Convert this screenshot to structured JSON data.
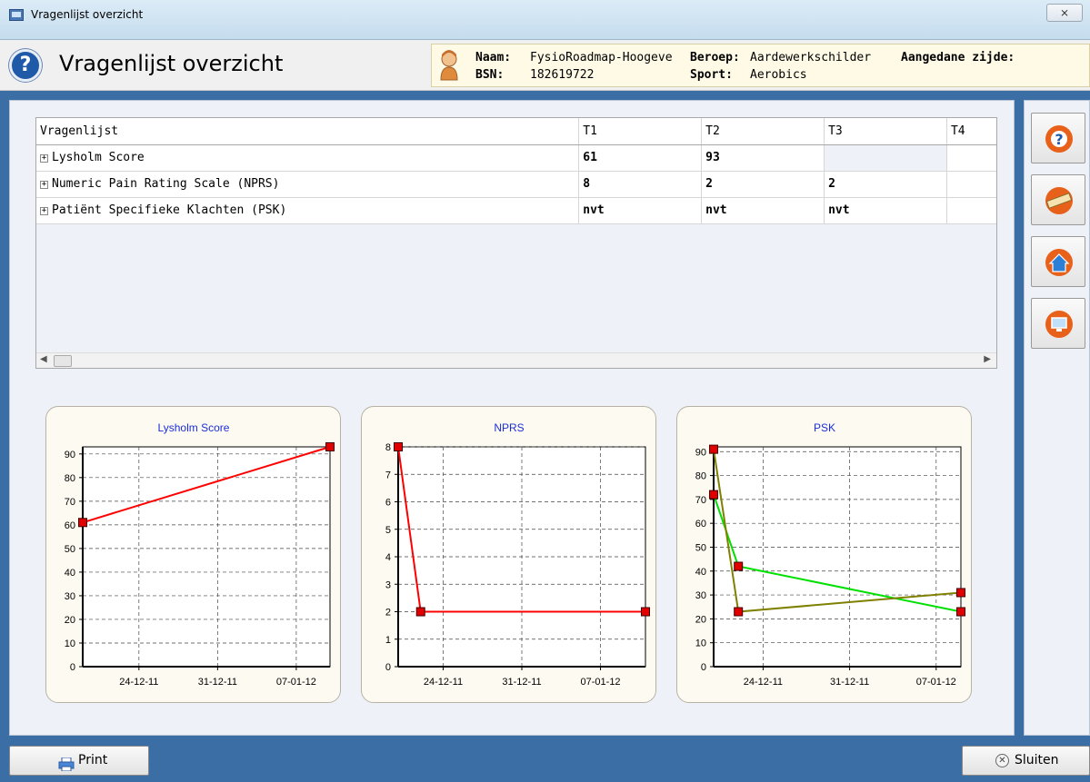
{
  "window": {
    "title": "Vragenlijst overzicht",
    "close_glyph": "⨯"
  },
  "header": {
    "title": "Vragenlijst overzicht",
    "help_icon": "question-icon"
  },
  "patient": {
    "naam_label": "Naam:",
    "naam": "FysioRoadmap-Hoogeve",
    "bsn_label": "BSN:",
    "bsn": "182619722",
    "beroep_label": "Beroep:",
    "beroep": "Aardewerkschilder",
    "sport_label": "Sport:",
    "sport": "Aerobics",
    "zijde_label": "Aangedane zijde:"
  },
  "grid": {
    "columns": [
      "Vragenlijst",
      "T1",
      "T2",
      "T3",
      "T4"
    ],
    "rows": [
      {
        "name": "Lysholm Score",
        "values": [
          "61",
          "93",
          "",
          ""
        ]
      },
      {
        "name": "Numeric Pain Rating Scale (NPRS)",
        "values": [
          "8",
          "2",
          "2",
          ""
        ]
      },
      {
        "name": "Patiënt Specifieke Klachten (PSK)",
        "values": [
          "nvt",
          "nvt",
          "nvt",
          ""
        ]
      }
    ]
  },
  "chart_data": [
    {
      "type": "line",
      "title": "Lysholm Score",
      "x_ticks": [
        "24-12-11",
        "31-12-11",
        "07-01-12"
      ],
      "y_ticks": [
        "0",
        "10",
        "20",
        "30",
        "40",
        "50",
        "60",
        "70",
        "80",
        "90"
      ],
      "ylim": [
        0,
        93
      ],
      "series": [
        {
          "color": "#ff0000",
          "points": [
            {
              "x": "2011-12-19",
              "y": 61
            },
            {
              "x": "2012-01-10",
              "y": 93
            }
          ]
        }
      ]
    },
    {
      "type": "line",
      "title": "NPRS",
      "x_ticks": [
        "24-12-11",
        "31-12-11",
        "07-01-12"
      ],
      "y_ticks": [
        "0",
        "1",
        "2",
        "3",
        "4",
        "5",
        "6",
        "7",
        "8"
      ],
      "ylim": [
        0,
        8
      ],
      "series": [
        {
          "color": "#ff0000",
          "points": [
            {
              "x": "2011-12-20",
              "y": 8
            },
            {
              "x": "2011-12-22",
              "y": 2
            },
            {
              "x": "2012-01-11",
              "y": 2
            }
          ]
        }
      ]
    },
    {
      "type": "line",
      "title": "PSK",
      "x_ticks": [
        "24-12-11",
        "31-12-11",
        "07-01-12"
      ],
      "y_ticks": [
        "0",
        "10",
        "20",
        "30",
        "40",
        "50",
        "60",
        "70",
        "80",
        "90"
      ],
      "ylim": [
        0,
        92
      ],
      "series": [
        {
          "color": "#00e000",
          "points": [
            {
              "x": "2011-12-20",
              "y": 72
            },
            {
              "x": "2011-12-22",
              "y": 42
            },
            {
              "x": "2012-01-09",
              "y": 23
            }
          ]
        },
        {
          "color": "#808000",
          "points": [
            {
              "x": "2011-12-20",
              "y": 91
            },
            {
              "x": "2011-12-22",
              "y": 23
            },
            {
              "x": "2012-01-09",
              "y": 31
            }
          ]
        }
      ]
    }
  ],
  "sidebar": {
    "buttons": [
      {
        "icon": "help-lifebuoy-icon",
        "color": "#e8611a"
      },
      {
        "icon": "ruler-icon",
        "color": "#e8611a"
      },
      {
        "icon": "home-icon",
        "color": "#e8611a"
      },
      {
        "icon": "monitor-icon",
        "color": "#e8611a"
      }
    ]
  },
  "footer": {
    "print_label": "Print",
    "close_label": "Sluiten"
  }
}
